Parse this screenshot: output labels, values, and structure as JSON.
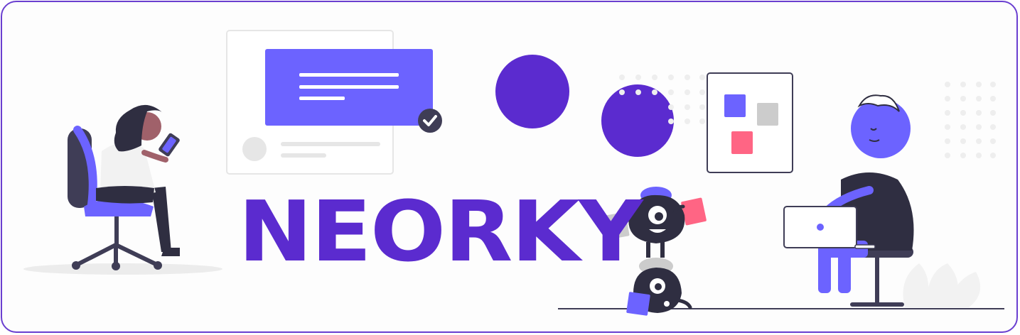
{
  "banner": {
    "brand_name": "NEORKY"
  },
  "colors": {
    "brand": "#5b2bcf",
    "accent": "#6c63ff",
    "frame": "#6a3fd0",
    "dark": "#2f2e41",
    "pink": "#ff6584",
    "gray": "#cccccc"
  },
  "icons": [
    "check-icon"
  ]
}
